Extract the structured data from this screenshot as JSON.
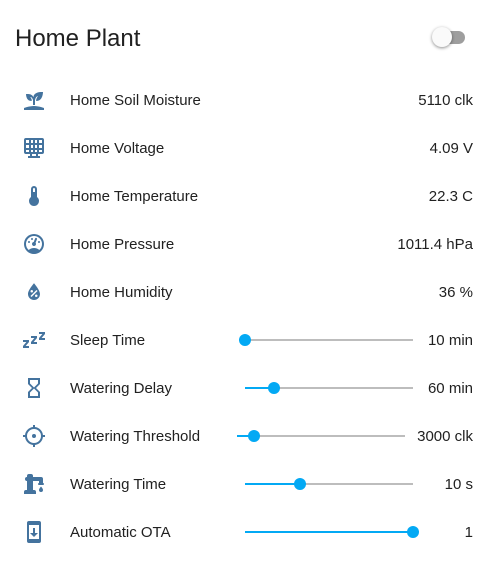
{
  "card": {
    "title": "Home Plant",
    "toggle_state": "off"
  },
  "rows": [
    {
      "label": "Home Soil Moisture",
      "value": "5110 clk",
      "icon": "sprout-icon"
    },
    {
      "label": "Home Voltage",
      "value": "4.09 V",
      "icon": "solar-panel-icon"
    },
    {
      "label": "Home Temperature",
      "value": "22.3 C",
      "icon": "thermometer-icon"
    },
    {
      "label": "Home Pressure",
      "value": "1011.4 hPa",
      "icon": "gauge-icon"
    },
    {
      "label": "Home Humidity",
      "value": "36 %",
      "icon": "water-percent-icon"
    },
    {
      "label": "Sleep Time",
      "value": "10 min",
      "icon": "sleep-icon",
      "slider_fraction": 0.0
    },
    {
      "label": "Watering Delay",
      "value": "60 min",
      "icon": "hourglass-icon",
      "slider_fraction": 0.17
    },
    {
      "label": "Watering Threshold",
      "value": "3000 clk",
      "icon": "crosshairs-icon",
      "slider_fraction": 0.1
    },
    {
      "label": "Watering Time",
      "value": "10 s",
      "icon": "water-pump-icon",
      "slider_fraction": 0.33
    },
    {
      "label": "Automatic OTA",
      "value": "1",
      "icon": "cellphone-arrow-down-icon",
      "slider_fraction": 1.0
    }
  ],
  "colors": {
    "icon": "#44739e",
    "slider_active": "#03a9f4",
    "slider_rail": "#bdbdbd",
    "toggle_track": "#9e9e9e"
  }
}
